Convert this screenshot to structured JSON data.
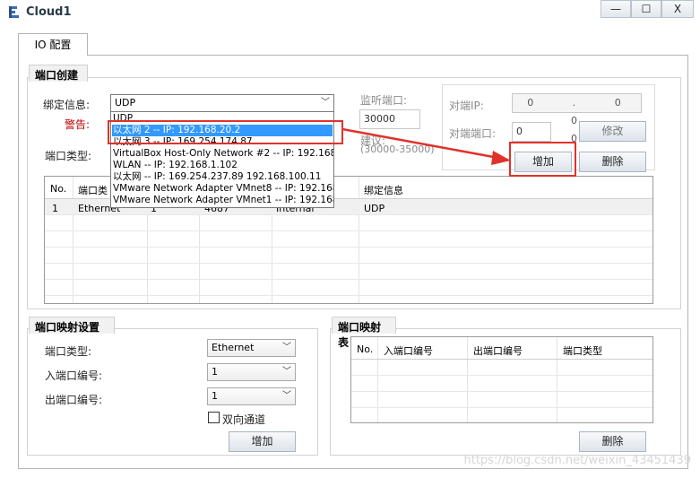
{
  "window": {
    "title": "Cloud1",
    "min_label": "—",
    "max_label": "☐",
    "close_label": "X"
  },
  "tabs": [
    {
      "label": "IO 配置"
    }
  ],
  "port_create": {
    "title": "端口创建",
    "bind_label": "绑定信息:",
    "warning_label": "警告:",
    "port_type_label": "端口类型:",
    "bind_selected": "UDP",
    "listen_port_label": "监听端口:",
    "listen_port_value": "30000",
    "suggest_label": "建议:",
    "suggest_range": "(30000-35000)",
    "peer_ip_label": "对端IP:",
    "peer_ip_value": "0 . 0 . 0 . 0",
    "peer_port_label": "对端端口:",
    "peer_port_value": "0",
    "modify_button": "修改",
    "add_button": "增加",
    "delete_button": "删除"
  },
  "bind_dropdown": {
    "options": [
      "UDP",
      "以太网 2 -- IP: 192.168.20.2",
      "以太网 3 -- IP: 169.254.174.87",
      "VirtualBox Host-Only Network #2 -- IP: 192.168.56.",
      "WLAN -- IP: 192.168.1.102",
      "以太网 -- IP: 169.254.237.89 192.168.100.11",
      "VMware Network Adapter VMnet8 -- IP: 192.168.1.",
      "VMware Network Adapter VMnet1 -- IP: 192.168.40."
    ],
    "highlighted_index": 1
  },
  "port_table": {
    "headers": [
      "No.",
      "端口类",
      "",
      "",
      "",
      "绑定信息"
    ],
    "rows": [
      [
        "1",
        "Ethernet",
        "1",
        "4687",
        "Internal",
        "UDP"
      ]
    ]
  },
  "port_mapping": {
    "title": "端口映射设置",
    "type_label": "端口类型:",
    "type_value": "Ethernet",
    "in_label": "入端口编号:",
    "in_value": "1",
    "out_label": "出端口编号:",
    "out_value": "1",
    "bidirectional_label": "双向通道",
    "add_button": "增加"
  },
  "mapping_table": {
    "title": "端口映射表",
    "headers": [
      "No.",
      "入端口编号",
      "出端口编号",
      "端口类型"
    ],
    "delete_button": "删除"
  },
  "watermark": "https://blog.csdn.net/weixin_43451439",
  "colors": {
    "annotation_red": "#e0322b",
    "selection_blue": "#3399ff"
  }
}
